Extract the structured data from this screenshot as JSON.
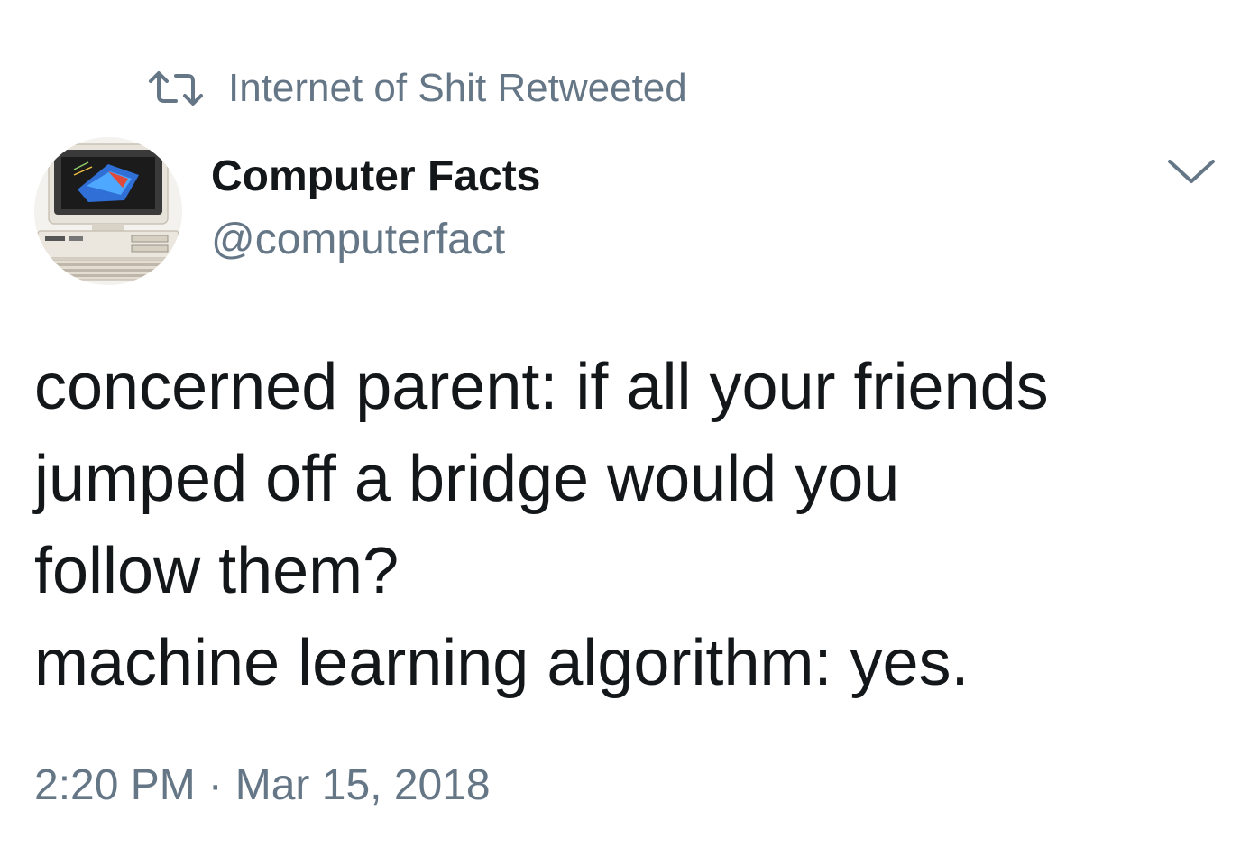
{
  "retweet": {
    "icon": "retweet-icon",
    "text": "Internet of Shit Retweeted"
  },
  "author": {
    "avatar": "vintage-computer-avatar",
    "display_name": "Computer Facts",
    "handle": "@computerfact"
  },
  "menu": {
    "icon": "chevron-down-icon"
  },
  "tweet": {
    "lines": [
      "concerned parent: if all your friends",
      "jumped off a bridge would you",
      "follow them?",
      "machine learning algorithm: yes."
    ]
  },
  "meta": {
    "time": "2:20 PM",
    "separator": "·",
    "date": "Mar 15, 2018"
  },
  "colors": {
    "text": "#14171a",
    "secondary": "#657786",
    "background": "#ffffff"
  }
}
